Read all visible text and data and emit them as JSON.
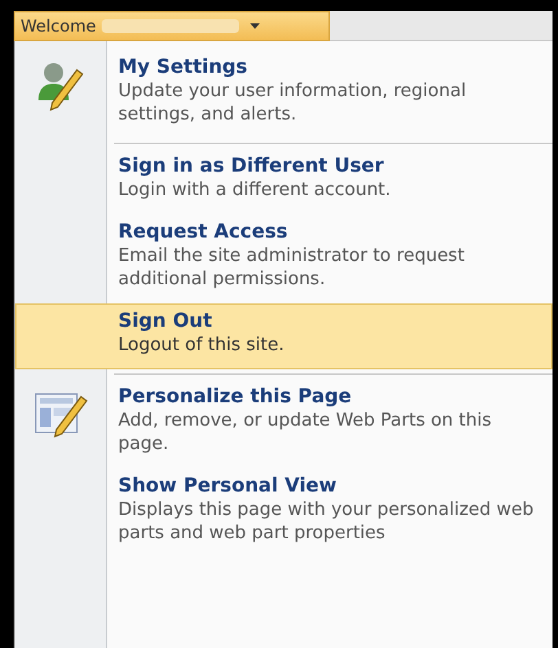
{
  "welcome": {
    "label": "Welcome"
  },
  "groups": [
    {
      "items": [
        {
          "kind": "user-settings",
          "title": "My Settings",
          "description": "Update your user information, regional settings, and alerts.",
          "selected": false
        }
      ]
    },
    {
      "items": [
        {
          "kind": "plain",
          "title": "Sign in as Different User",
          "description": "Login with a different account.",
          "selected": false
        },
        {
          "kind": "plain",
          "title": "Request Access",
          "description": "Email the site administrator to request additional permissions.",
          "selected": false
        },
        {
          "kind": "plain",
          "title": "Sign Out",
          "description": "Logout of this site.",
          "selected": true
        }
      ]
    },
    {
      "items": [
        {
          "kind": "page-edit",
          "title": "Personalize this Page",
          "description": "Add, remove, or update Web Parts on this page.",
          "selected": false
        },
        {
          "kind": "plain",
          "title": "Show Personal View",
          "description": "Displays this page with your personalized web parts and web part properties",
          "selected": false
        }
      ]
    }
  ]
}
